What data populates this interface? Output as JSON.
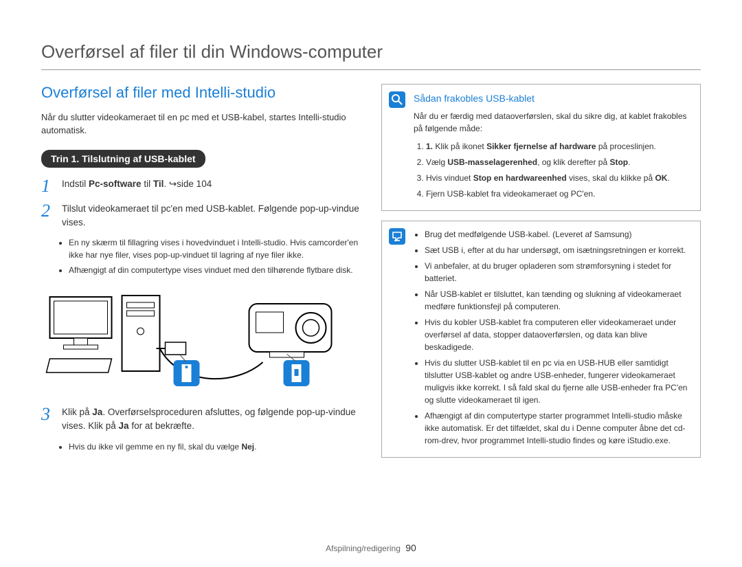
{
  "page_title": "Overførsel af filer til din Windows-computer",
  "section_heading": "Overførsel af filer med Intelli-studio",
  "intro": "Når du slutter videokameraet til en pc med et USB-kabel, startes Intelli-studio automatisk.",
  "step_label": "Trin 1. Tilslutning af USB-kablet",
  "steps": {
    "s1_pre": "Indstil ",
    "s1_b1": "Pc-software",
    "s1_mid": " til ",
    "s1_b2": "Til",
    "s1_post": ". ",
    "s1_ref": "↪side 104",
    "s2": "Tilslut videokameraet til pc'en med USB-kablet. Følgende pop-up-vindue vises.",
    "s2_bullets": [
      "En ny skærm til fillagring vises i hovedvinduet i Intelli-studio. Hvis camcorder'en ikke har nye filer, vises pop-up-vinduet til lagring af nye filer ikke.",
      "Afhængigt af din computertype vises vinduet med den tilhørende flytbare disk."
    ],
    "s3_pre": "Klik på ",
    "s3_b1": "Ja",
    "s3_mid": ". Overførselsproceduren afsluttes, og følgende pop-up-vindue vises. Klik på ",
    "s3_b2": "Ja",
    "s3_post": " for at bekræfte.",
    "s3_bullet_pre": "Hvis du ikke vil gemme en ny fil, skal du vælge ",
    "s3_bullet_b": "Nej",
    "s3_bullet_post": "."
  },
  "notebox1": {
    "title": "Sådan frakobles USB-kablet",
    "intro": "Når du er færdig med dataoverførslen, skal du sikre dig, at kablet frakobles på følgende måde:",
    "items": [
      {
        "pre": "Klik på ikonet ",
        "b": "Sikker fjernelse af hardware",
        "post": " på proceslinjen."
      },
      {
        "pre": "Vælg ",
        "b": "USB-masselagerenhed",
        "mid": ", og klik derefter på ",
        "b2": "Stop",
        "post": "."
      },
      {
        "pre": "Hvis vinduet ",
        "b": "Stop en hardwareenhed",
        "mid": " vises, skal du klikke på ",
        "b2": "OK",
        "post": "."
      },
      {
        "plain": "Fjern USB-kablet fra videokameraet og PC'en."
      }
    ]
  },
  "notebox2": {
    "items": [
      "Brug det medfølgende USB-kabel. (Leveret af Samsung)",
      "Sæt USB i, efter at du har undersøgt, om isætningsretningen er korrekt.",
      "Vi anbefaler, at du bruger opladeren som strømforsyning i stedet for batteriet.",
      "Når USB-kablet er tilsluttet, kan tænding og slukning af videokameraet medføre funktionsfejl på computeren.",
      "Hvis du kobler USB-kablet fra computeren eller videokameraet under overførsel af data, stopper dataoverførslen, og data kan blive beskadigede.",
      "Hvis du slutter USB-kablet til en pc via en USB-HUB eller samtidigt tilslutter USB-kablet og andre USB-enheder, fungerer videokameraet muligvis ikke korrekt. I så fald skal du fjerne alle USB-enheder fra PC'en og slutte videokameraet til igen.",
      "Afhængigt af din computertype starter programmet Intelli-studio måske ikke automatisk. Er det tilfældet, skal du i Denne computer åbne det cd-rom-drev, hvor programmet Intelli-studio findes og køre iStudio.exe."
    ]
  },
  "footer": {
    "section": "Afspilning/redigering",
    "page": "90"
  }
}
